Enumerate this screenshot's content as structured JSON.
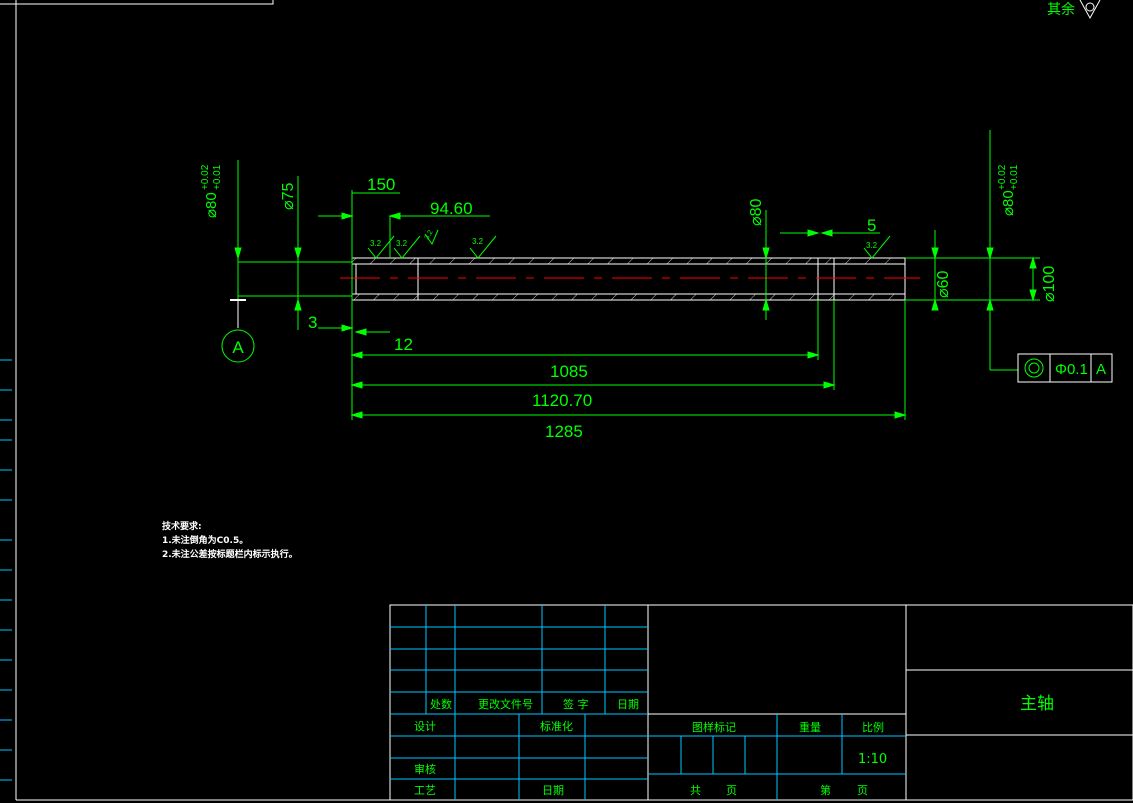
{
  "corner_label": "其余",
  "surface_finish": [
    "3.2",
    "3.2",
    "3.2",
    "3.2",
    "3.2"
  ],
  "dimensions": {
    "dia_left": "⌀80",
    "dia_left_tol_upper": "+0.02",
    "dia_left_tol_lower": "+0.01",
    "dia_75": "⌀75",
    "len_150": "150",
    "len_94_60": "94.60",
    "dia_80_mid": "⌀80",
    "len_5": "5",
    "dia_right": "⌀80",
    "dia_right_tol_upper": "+0.02",
    "dia_right_tol_lower": "+0.01",
    "dia_60": "⌀60",
    "dia_100": "⌀100",
    "len_3": "3",
    "len_12": "12",
    "len_1085": "1085",
    "len_1120_70": "1120.70",
    "len_1285": "1285"
  },
  "datum": "A",
  "tolerance_frame": {
    "symbol": "◎",
    "value": "Φ0.1",
    "datum_ref": "A"
  },
  "technical_requirements": {
    "title": "技术要求:",
    "items": [
      "1.未注倒角为C0.5。",
      "2.未注公差按标题栏内标示执行。"
    ]
  },
  "title_block": {
    "rev_headers": [
      "处数",
      "更改文件号",
      "签 字",
      "日期"
    ],
    "roles": {
      "design": "设计",
      "standardization": "标准化",
      "review": "审核",
      "process": "工艺",
      "date": "日期"
    },
    "drawing_mark": "图样标记",
    "weight": "重量",
    "scale_label": "比例",
    "scale_value": "1:10",
    "total": "共",
    "sheet_unit": "页",
    "sheet_no": "第",
    "part_name": "主轴"
  }
}
